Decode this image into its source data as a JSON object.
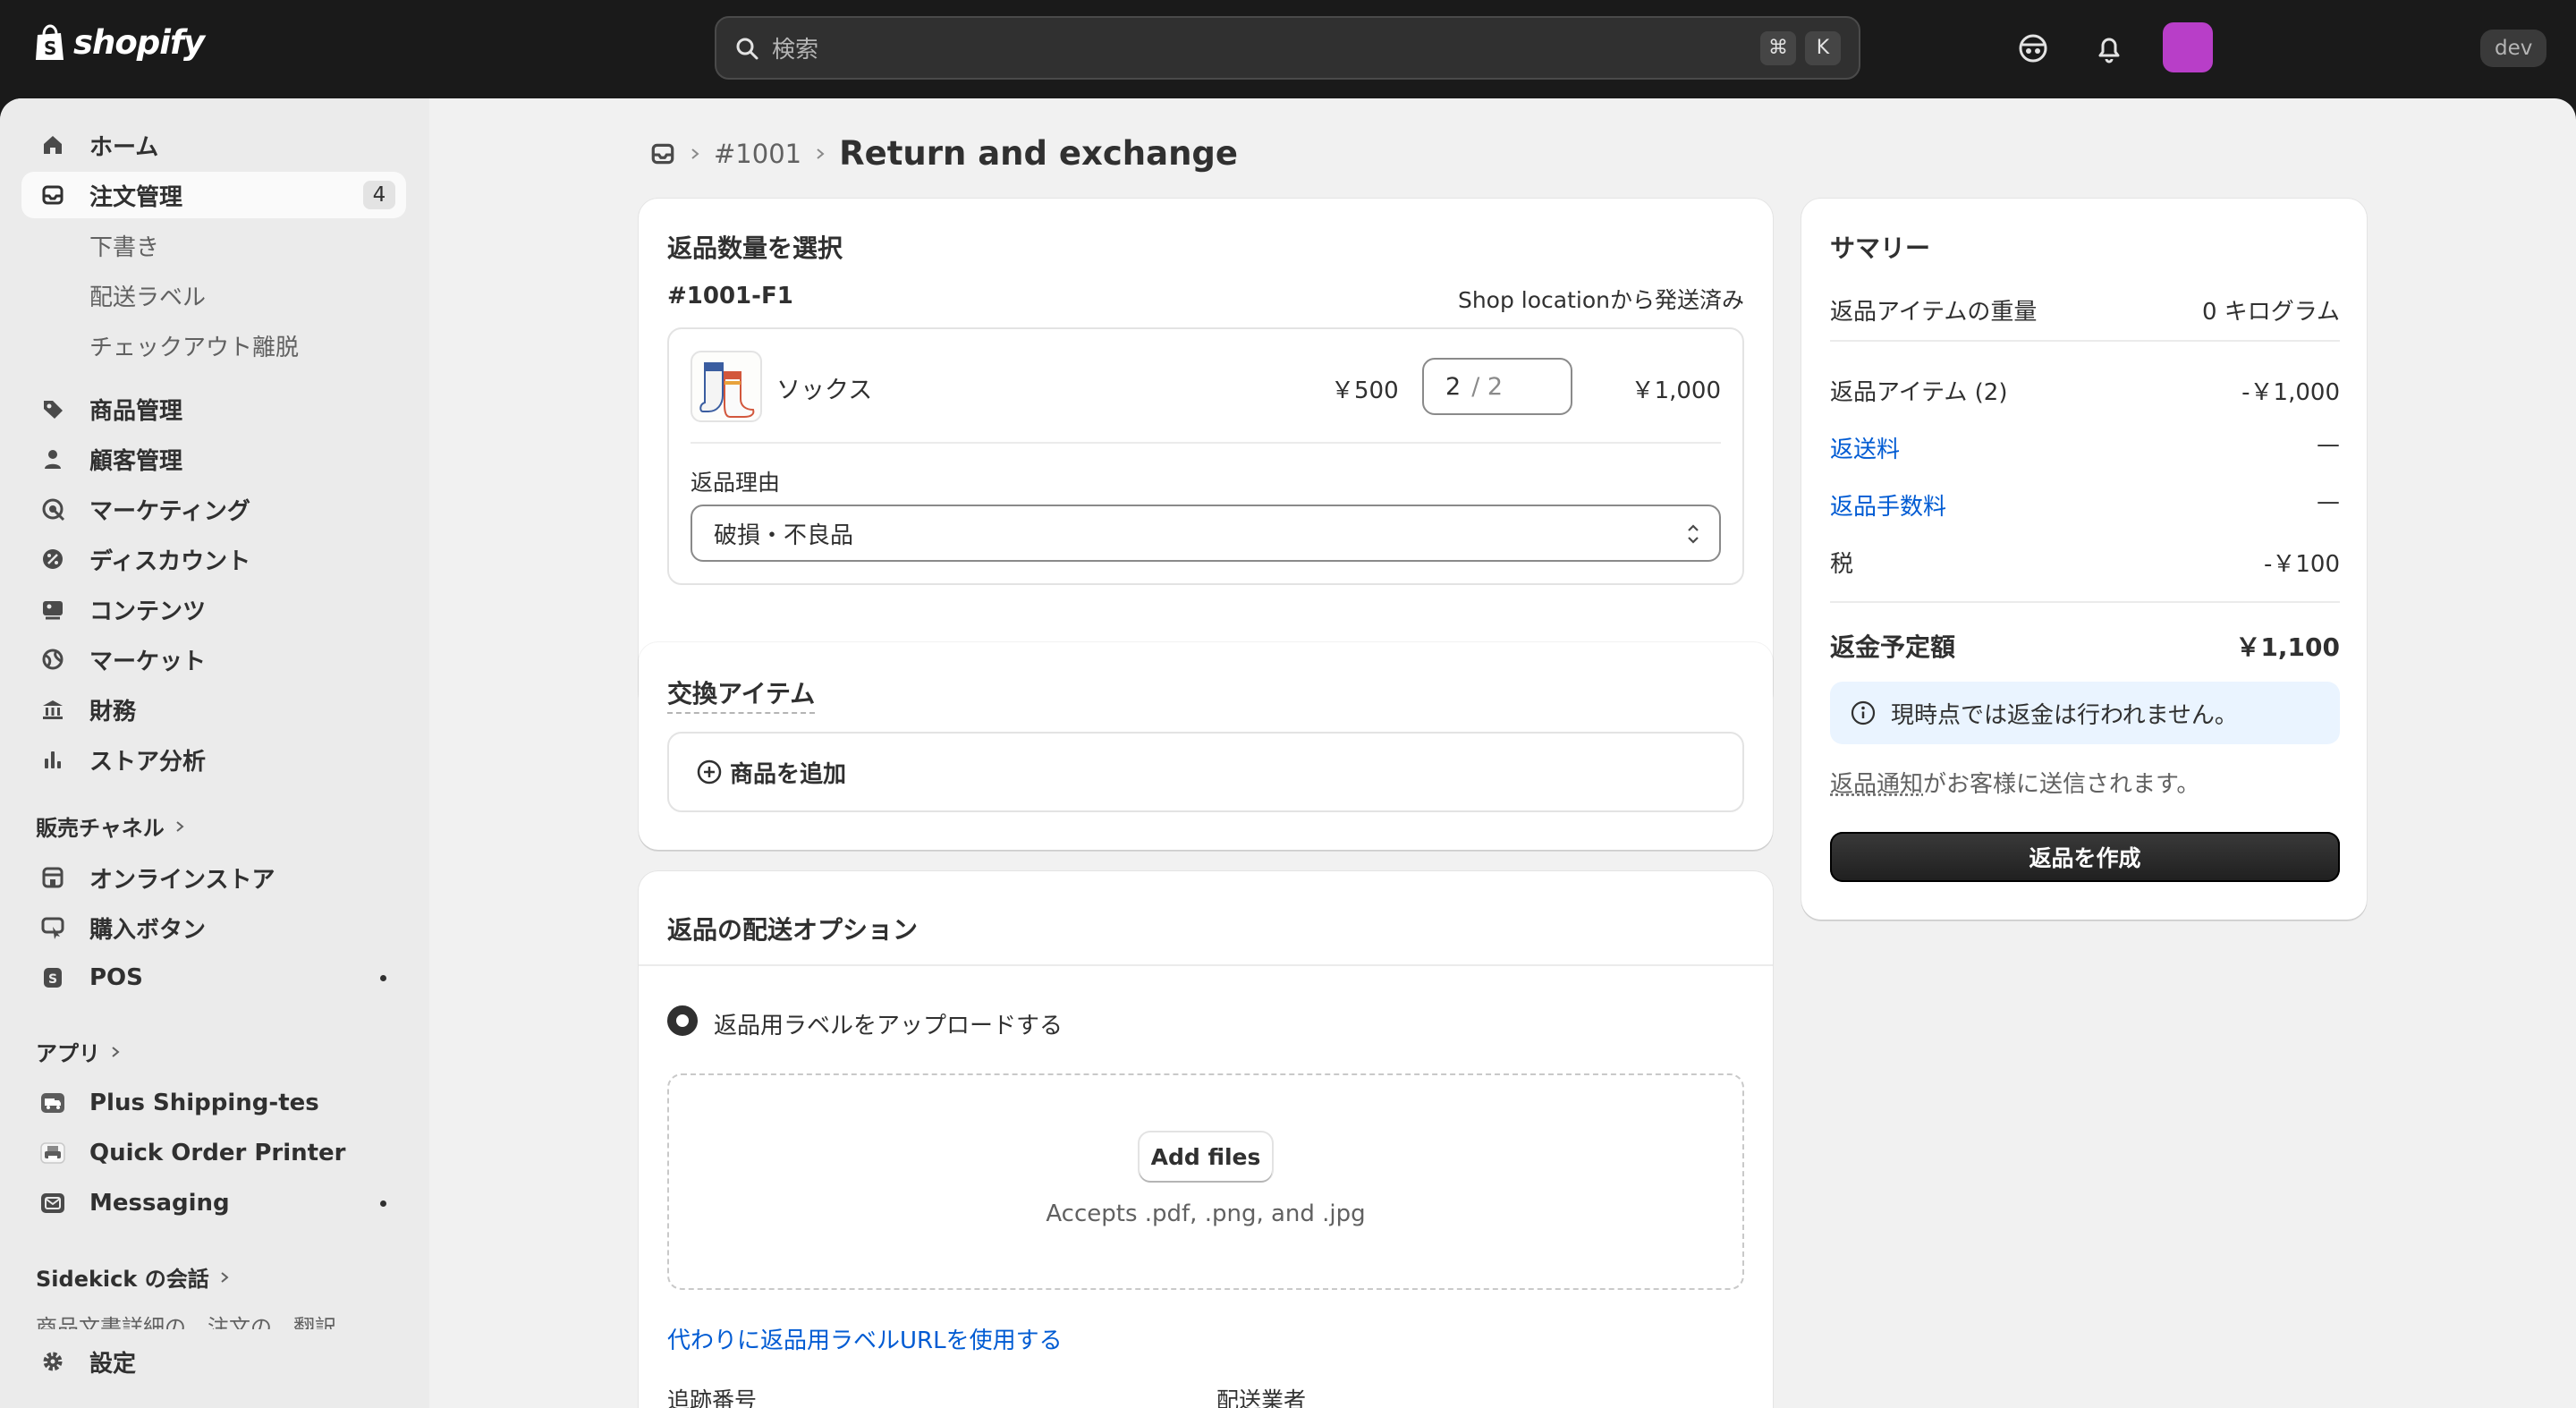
{
  "topbar": {
    "logo_text": "shopify",
    "search_placeholder": "検索",
    "shortcut_keys": [
      "⌘",
      "K"
    ],
    "store_badge": "dev",
    "avatar_color": "#b83ec8"
  },
  "sidebar": {
    "items": [
      {
        "label": "ホーム",
        "icon": "home-icon"
      },
      {
        "label": "注文管理",
        "icon": "inbox-icon",
        "badge": "4",
        "active": true
      },
      {
        "label": "下書き"
      },
      {
        "label": "配送ラベル"
      },
      {
        "label": "チェックアウト離脱"
      },
      {
        "label": "商品管理",
        "icon": "tag-icon"
      },
      {
        "label": "顧客管理",
        "icon": "person-icon"
      },
      {
        "label": "マーケティング",
        "icon": "target-icon"
      },
      {
        "label": "ディスカウント",
        "icon": "discount-icon"
      },
      {
        "label": "コンテンツ",
        "icon": "content-icon"
      },
      {
        "label": "マーケット",
        "icon": "globe-icon"
      },
      {
        "label": "財務",
        "icon": "bank-icon"
      },
      {
        "label": "ストア分析",
        "icon": "chart-bar-icon"
      }
    ],
    "sales_channels_label": "販売チャネル",
    "channels": [
      {
        "label": "オンラインストア",
        "icon": "store-icon"
      },
      {
        "label": "購入ボタン",
        "icon": "buy-button-icon"
      },
      {
        "label": "POS",
        "icon": "pos-icon"
      }
    ],
    "apps_label": "アプリ",
    "apps": [
      {
        "label": "Plus Shipping-tes",
        "icon": "truck-app-icon"
      },
      {
        "label": "Quick Order Printer",
        "icon": "printer-app-icon"
      },
      {
        "label": "Messaging",
        "icon": "messaging-app-icon"
      }
    ],
    "sidekick_label": "Sidekick の会話",
    "sidekick_cut_text": "商品文書詳細の　注文の　翻訳",
    "settings_label": "設定"
  },
  "breadcrumb": {
    "order": "#1001",
    "title": "Return and exchange"
  },
  "return_card": {
    "title": "返品数量を選択",
    "fulfillment_id": "#1001-F1",
    "fulfillment_status": "Shop locationから発送済み",
    "item": {
      "name": "ソックス",
      "unit_price": "￥500",
      "qty": "2",
      "qty_max": "/ 2",
      "total": "￥1,000"
    },
    "reason_label": "返品理由",
    "reason_value": "破損・不良品"
  },
  "exchange_card": {
    "title": "交換アイテム",
    "add_button": "商品を追加"
  },
  "shipping_card": {
    "title": "返品の配送オプション",
    "radio_label": "返品用ラベルをアップロードする",
    "add_files": "Add files",
    "accepts": "Accepts .pdf, .png, and .jpg",
    "url_link": "代わりに返品用ラベルURLを使用する",
    "tracking_label": "追跡番号",
    "carrier_label": "配送業者"
  },
  "summary": {
    "title": "サマリー",
    "weight_label": "返品アイテムの重量",
    "weight_value": "0 キログラム",
    "items_label": "返品アイテム (2)",
    "items_value": "-￥1,000",
    "shipping_label": "返送料",
    "shipping_value": "—",
    "fee_label": "返品手数料",
    "fee_value": "—",
    "tax_label": "税",
    "tax_value": "-￥100",
    "refund_label": "返金予定額",
    "refund_value": "￥1,100",
    "info_text": "現時点では返金は行われません。",
    "notice_link": "返品通知",
    "notice_rest": "がお客様に送信されます。",
    "create_button": "返品を作成"
  }
}
